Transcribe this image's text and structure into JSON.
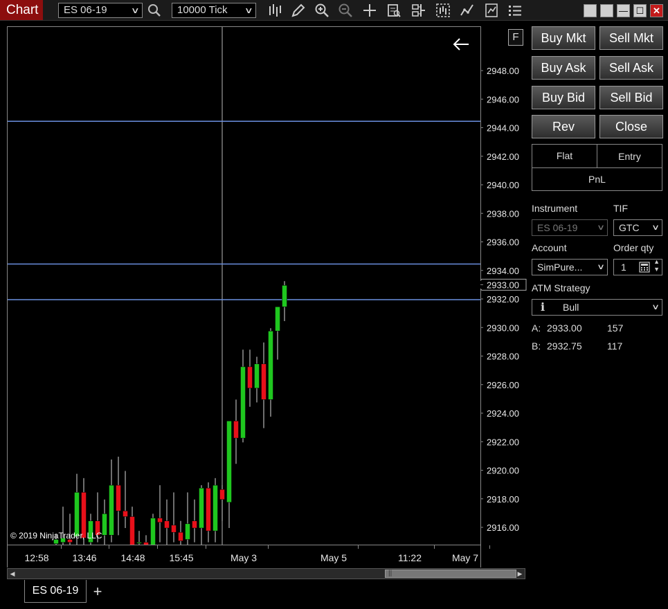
{
  "toolbar": {
    "title": "Chart",
    "instrument": "ES 06-19",
    "interval": "10000 Tick"
  },
  "chart": {
    "price_labels": [
      "2948.00",
      "2946.00",
      "2944.00",
      "2942.00",
      "2940.00",
      "2938.00",
      "2936.00",
      "2934.00",
      "2933.00",
      "2932.00",
      "2930.00",
      "2928.00",
      "2926.00",
      "2924.00",
      "2922.00",
      "2920.00",
      "2918.00",
      "2916.00"
    ],
    "current_price": "2933.00",
    "time_labels": [
      "12:58",
      "13:46",
      "14:48",
      "15:45",
      "May 3",
      "May 5",
      "11:22",
      "May 7"
    ],
    "copyright": "© 2019 NinjaTrader, LLC",
    "f_label": "F",
    "horizontal_lines": [
      2944.5,
      2934.5,
      2932.0
    ],
    "line_color": "#6b8fe0",
    "candles": [
      {
        "o": 2914.9,
        "h": 2915.6,
        "l": 2914.2,
        "c": 2915.2
      },
      {
        "o": 2915.0,
        "h": 2917.5,
        "l": 2913.8,
        "c": 2915.3
      },
      {
        "o": 2915.2,
        "h": 2917.0,
        "l": 2913.5,
        "c": 2915.0
      },
      {
        "o": 2915.4,
        "h": 2919.8,
        "l": 2914.6,
        "c": 2918.5
      },
      {
        "o": 2918.5,
        "h": 2919.5,
        "l": 2914.5,
        "c": 2915.3
      },
      {
        "o": 2915.0,
        "h": 2917.0,
        "l": 2914.5,
        "c": 2916.5
      },
      {
        "o": 2916.5,
        "h": 2918.5,
        "l": 2915.0,
        "c": 2915.5
      },
      {
        "o": 2915.5,
        "h": 2918.0,
        "l": 2914.8,
        "c": 2917.0
      },
      {
        "o": 2915.5,
        "h": 2920.8,
        "l": 2915.0,
        "c": 2919.0
      },
      {
        "o": 2919.0,
        "h": 2921.0,
        "l": 2915.5,
        "c": 2917.2
      },
      {
        "o": 2917.2,
        "h": 2920.0,
        "l": 2916.0,
        "c": 2916.8
      },
      {
        "o": 2916.8,
        "h": 2917.5,
        "l": 2914.2,
        "c": 2914.8
      },
      {
        "o": 2915.0,
        "h": 2915.8,
        "l": 2914.5,
        "c": 2915.0
      },
      {
        "o": 2915.0,
        "h": 2915.5,
        "l": 2914.0,
        "c": 2914.8
      },
      {
        "o": 2914.8,
        "h": 2917.0,
        "l": 2914.5,
        "c": 2916.7
      },
      {
        "o": 2916.7,
        "h": 2919.0,
        "l": 2915.0,
        "c": 2916.4
      },
      {
        "o": 2916.5,
        "h": 2918.0,
        "l": 2914.0,
        "c": 2916.0
      },
      {
        "o": 2916.2,
        "h": 2918.5,
        "l": 2915.0,
        "c": 2915.7
      },
      {
        "o": 2915.7,
        "h": 2916.5,
        "l": 2914.5,
        "c": 2915.1
      },
      {
        "o": 2915.2,
        "h": 2918.5,
        "l": 2914.5,
        "c": 2916.3
      },
      {
        "o": 2916.5,
        "h": 2918.0,
        "l": 2915.0,
        "c": 2916.0
      },
      {
        "o": 2916.0,
        "h": 2919.0,
        "l": 2914.8,
        "c": 2918.8
      },
      {
        "o": 2918.8,
        "h": 2919.2,
        "l": 2915.0,
        "c": 2915.8
      },
      {
        "o": 2915.8,
        "h": 2919.5,
        "l": 2915.0,
        "c": 2919.0
      },
      {
        "o": 2918.7,
        "h": 2919.0,
        "l": 2916.5,
        "c": 2918.0
      },
      {
        "o": 2917.8,
        "h": 2920.0,
        "l": 2916.0,
        "c": 2923.5
      },
      {
        "o": 2923.5,
        "h": 2925.0,
        "l": 2920.5,
        "c": 2922.3
      },
      {
        "o": 2922.3,
        "h": 2928.5,
        "l": 2922.0,
        "c": 2927.3
      },
      {
        "o": 2927.3,
        "h": 2928.5,
        "l": 2924.5,
        "c": 2925.8
      },
      {
        "o": 2925.8,
        "h": 2928.0,
        "l": 2924.8,
        "c": 2927.5
      },
      {
        "o": 2927.5,
        "h": 2929.0,
        "l": 2923.0,
        "c": 2925.0
      },
      {
        "o": 2925.0,
        "h": 2930.0,
        "l": 2923.8,
        "c": 2929.8
      },
      {
        "o": 2929.8,
        "h": 2931.5,
        "l": 2927.8,
        "c": 2931.5
      },
      {
        "o": 2931.5,
        "h": 2933.3,
        "l": 2930.5,
        "c": 2933.0
      }
    ]
  },
  "order_panel": {
    "buy_mkt": "Buy Mkt",
    "sell_mkt": "Sell Mkt",
    "buy_ask": "Buy Ask",
    "sell_ask": "Sell Ask",
    "buy_bid": "Buy Bid",
    "sell_bid": "Sell Bid",
    "rev": "Rev",
    "close": "Close",
    "position": {
      "flat": "Flat",
      "entry": "Entry",
      "pnl": "PnL"
    },
    "instrument_label": "Instrument",
    "instrument_value": "ES 06-19",
    "tif_label": "TIF",
    "tif_value": "GTC",
    "account_label": "Account",
    "account_value": "SimPure...",
    "qty_label": "Order qty",
    "qty_value": "1",
    "atm_label": "ATM Strategy",
    "atm_info": "i",
    "atm_value": "Bull",
    "ask_label": "A:",
    "ask_price": "2933.00",
    "ask_size": "157",
    "bid_label": "B:",
    "bid_price": "2932.75",
    "bid_size": "117"
  },
  "tabs": {
    "active": "ES 06-19",
    "add": "+"
  },
  "colors": {
    "up": "#1fc71f",
    "down": "#e8101a",
    "title_bg": "#8c0e0e"
  }
}
